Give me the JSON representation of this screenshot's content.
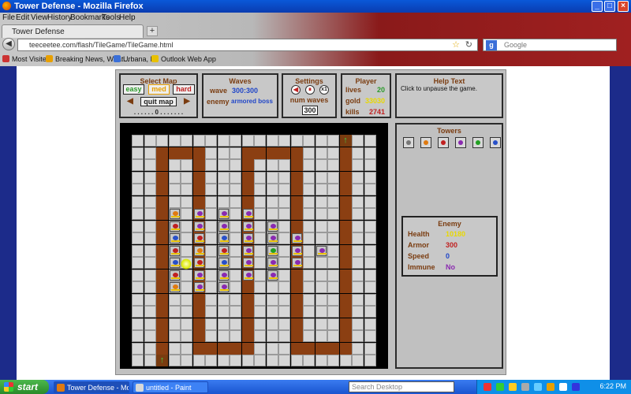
{
  "window": {
    "title": "Tower Defense - Mozilla Firefox"
  },
  "menu": [
    "File",
    "Edit",
    "View",
    "History",
    "Bookmarks",
    "Tools",
    "Help"
  ],
  "tab": {
    "label": "Tower Defense",
    "new_tab": "+"
  },
  "nav": {
    "url": "teeceetee.com/flash/TileGame/TileGame.html",
    "search_placeholder": "Google"
  },
  "bookmarks": [
    "Most Visited",
    "Breaking News, Weat...",
    "Urbana, IL",
    "Outlook Web App"
  ],
  "game": {
    "select_map": {
      "heading": "Select Map",
      "easy": "easy",
      "med": "med",
      "hard": "hard",
      "quit": "quit map",
      "prev": "◀",
      "next": "▶",
      "indicator": ". . . . . . 0 . . . . . . ."
    },
    "waves": {
      "heading": "Waves",
      "wave_label": "wave",
      "wave_value": "300:300",
      "enemy_label": "enemy",
      "enemy_value": "armored boss"
    },
    "settings": {
      "heading": "Settings",
      "speed": "x1",
      "num_waves_label": "num waves",
      "num_waves_value": "300"
    },
    "player": {
      "heading": "Player",
      "lives_label": "lives",
      "lives_value": "20",
      "gold_label": "gold",
      "gold_value": "33030",
      "kills_label": "kills",
      "kills_value": "2741"
    },
    "help": {
      "heading": "Help Text",
      "text": "Click to unpause the game."
    },
    "towers": {
      "heading": "Towers"
    },
    "enemy": {
      "heading": "Enemy",
      "health_label": "Health",
      "health_value": "10180",
      "armor_label": "Armor",
      "armor_value": "300",
      "speed_label": "Speed",
      "speed_value": "0",
      "immune_label": "Immune",
      "immune_value": "No"
    }
  },
  "colors": {
    "path": "#8b3f12",
    "label": "#7a3c10",
    "wave_blue": "#2046c8",
    "lives_green": "#2a9a2a",
    "gold_yellow": "#e8d800",
    "kills_red": "#c02020",
    "immune_purple": "#8a2ab0"
  },
  "taskbar": {
    "start": "start",
    "tasks": [
      "Tower Defense - Mozi...",
      "untitled - Paint"
    ],
    "search_placeholder": "Search Desktop",
    "clock": "6:22 PM"
  }
}
